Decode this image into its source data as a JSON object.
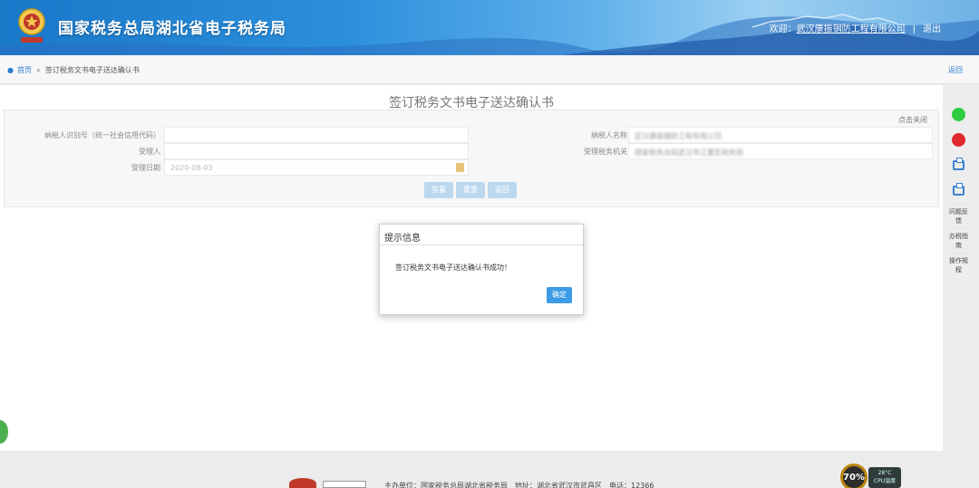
{
  "header": {
    "site_title": "国家税务总局湖北省电子税务局",
    "welcome": "欢迎：",
    "company": "武汉康振钢防工程有限公司",
    "separator": "|",
    "logout": "退出"
  },
  "breadcrumb": {
    "home": "首页",
    "separator": "»",
    "current": "签订税务文书电子送达确认书",
    "back": "返回"
  },
  "form": {
    "title": "签订税务文书电子送达确认书",
    "collapse": "点击关闭",
    "fields": {
      "taxpayer_id_label": "纳税人识别号（统一社会信用代码）",
      "taxpayer_id_value": "",
      "taxpayer_name_label": "纳税人名称",
      "taxpayer_name_value": "武汉康振钢防工程有限公司",
      "accepter_label": "受理人",
      "accepter_value": "",
      "tax_office_label": "受理税务机关",
      "tax_office_value": "国家税务总局武汉市江夏区税务局",
      "accept_date_label": "受理日期",
      "accept_date_value": "2020-08-03"
    },
    "buttons": {
      "sign": "签署",
      "reset": "重置",
      "back": "返回"
    }
  },
  "modal": {
    "title": "提示信息",
    "message": "签订税务文书电子送达确认书成功！",
    "ok": "确定"
  },
  "sidebar": {
    "items": [
      {
        "label": "问题反馈"
      },
      {
        "label": "办税指南"
      },
      {
        "label": "操作规程"
      }
    ]
  },
  "footer": {
    "text": "主办单位：国家税务总局湖北省税务局　地址：湖北省武汉市武昌区　电话：12366"
  },
  "cpu_widget": {
    "percent": "70%",
    "temp": "28°C",
    "label": "CPU温度"
  },
  "colors": {
    "accent": "#2b7bd0",
    "ok_button": "#3d9be5",
    "disabled_button": "#bcd8ef"
  }
}
